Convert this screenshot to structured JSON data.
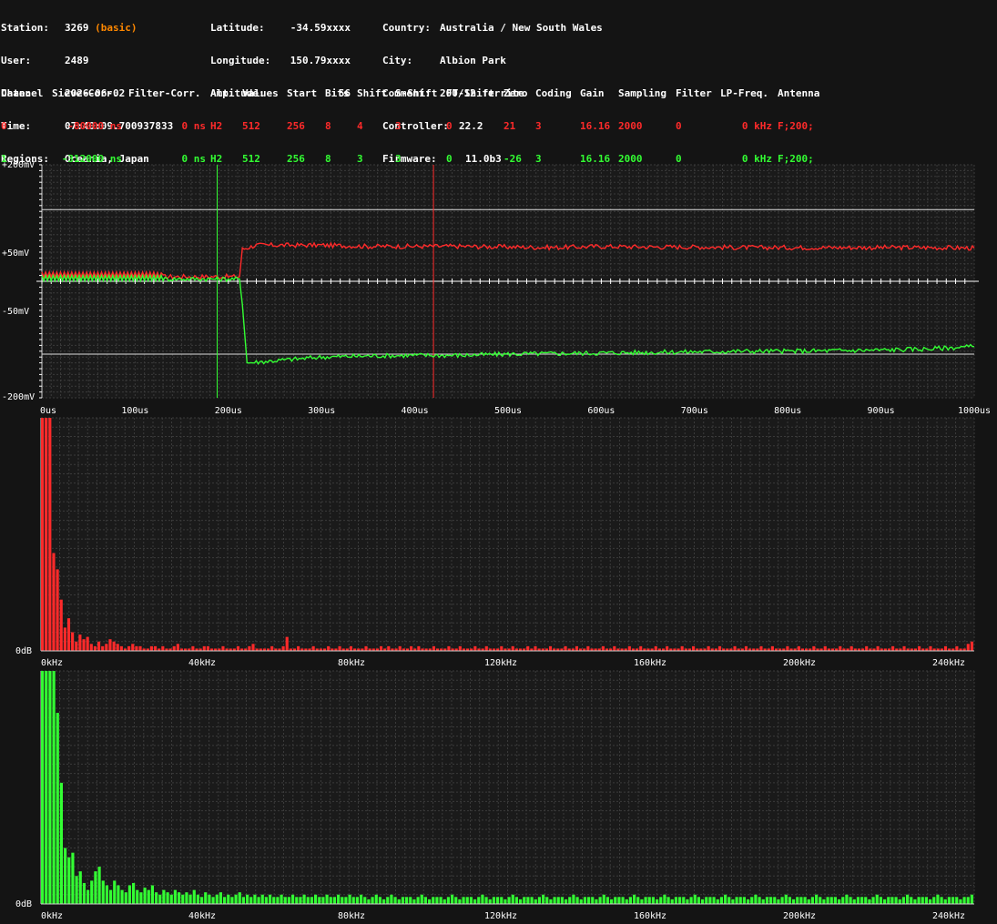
{
  "header": {
    "col1": [
      {
        "label": "Station:",
        "value": "3269",
        "extra": "(basic)"
      },
      {
        "label": "User:",
        "value": "2489"
      },
      {
        "label": "Date:",
        "value": "2026-06-02"
      },
      {
        "label": "Time:",
        "value": "07:40:09.700937833"
      },
      {
        "label": "Regions:",
        "value": "Oceania, Japan"
      }
    ],
    "col2": [
      {
        "label": "Latitude:",
        "value": "-34.59xxxx"
      },
      {
        "label": "Longitude:",
        "value": "150.79xxxx"
      },
      {
        "label": "Altitude:",
        "value": "56"
      }
    ],
    "col3": [
      {
        "label": "Country:",
        "value": "Australia / New South Wales"
      },
      {
        "label": "City:",
        "value": "Albion Park"
      },
      {
        "label": "Comment:",
        "value": "200/12 ferrite"
      },
      {
        "label": "Controller:",
        "value": "22.2"
      },
      {
        "label": "Firmware:",
        "value": "11.0b3"
      }
    ]
  },
  "channel_table": {
    "headers": [
      "Channel",
      "Sieve-Corr.",
      "Filter-Corr.",
      "Amp.",
      "Values",
      "Start",
      "Bits",
      "Shift",
      "S-Shift",
      "FT-Shift",
      "Zero",
      "Coding",
      "Gain",
      "Sampling",
      "Filter",
      "LP-Freq.",
      "Antenna"
    ],
    "rows": [
      {
        "color": "#ff2a2a",
        "cells": [
          "0",
          "-80000 ns",
          "0 ns",
          "H2",
          "512",
          "256",
          "8",
          "4",
          "3",
          "0",
          "21",
          "3",
          "16.16",
          "2000",
          "0",
          "0 kHz",
          "F;200;"
        ]
      },
      {
        "color": "#33ff33",
        "cells": [
          "1",
          "-312000 ns",
          "0 ns",
          "H2",
          "512",
          "256",
          "8",
          "3",
          "3",
          "0",
          "-26",
          "3",
          "16.16",
          "2000",
          "0",
          "0 kHz",
          "F;200;"
        ]
      }
    ]
  },
  "colors": {
    "background": "#141414",
    "plot_background": "#1a1a1a",
    "grid": "#3a3a3a",
    "ch0": "#ff2a2a",
    "ch1": "#33ff33"
  },
  "chart_data": [
    {
      "type": "line",
      "ylim": [
        -200,
        200
      ],
      "xlim": [
        0,
        1000
      ],
      "y_tick_labels": [
        {
          "value": 200,
          "label": "+200mV"
        },
        {
          "value": 50,
          "label": "+50mV"
        },
        {
          "value": -50,
          "label": "-50mV"
        },
        {
          "value": -200,
          "label": "-200mV"
        }
      ],
      "x_tick_labels": [
        "0us",
        "100us",
        "200us",
        "300us",
        "400us",
        "500us",
        "600us",
        "700us",
        "800us",
        "900us",
        "1000us"
      ],
      "reference_lines_mV": [
        123,
        -125
      ],
      "markers_us": [
        {
          "x": 188,
          "color": "#33ff33"
        },
        {
          "x": 420,
          "color": "#ff2a2a"
        }
      ],
      "series": [
        {
          "color": "#ff2a2a",
          "x": [
            0,
            60,
            120,
            130,
            180,
            200,
            212,
            215,
            230,
            260,
            300,
            350,
            400,
            450,
            500,
            550,
            600,
            650,
            700,
            750,
            800,
            850,
            900,
            950,
            1000
          ],
          "y": [
            10,
            10,
            10,
            8,
            8,
            8,
            8,
            55,
            62,
            62,
            62,
            60,
            60,
            60,
            59,
            58,
            60,
            59,
            59,
            58,
            58,
            58,
            58,
            58,
            57
          ]
        },
        {
          "color": "#33ff33",
          "x": [
            0,
            60,
            120,
            130,
            180,
            200,
            212,
            215,
            220,
            260,
            300,
            350,
            400,
            450,
            500,
            550,
            600,
            650,
            700,
            750,
            800,
            850,
            900,
            950,
            1000
          ],
          "y": [
            4,
            4,
            4,
            4,
            4,
            4,
            4,
            -40,
            -140,
            -135,
            -130,
            -128,
            -127,
            -127,
            -125,
            -124,
            -123,
            -122,
            -121,
            -120,
            -120,
            -119,
            -118,
            -116,
            -112
          ]
        }
      ]
    },
    {
      "type": "bar",
      "color": "#ff2a2a",
      "ylim": [
        0,
        100
      ],
      "y_tick_labels": [
        {
          "value": 0,
          "label": "0dB"
        }
      ],
      "x_tick_labels": [
        "0kHz",
        "40kHz",
        "80kHz",
        "120kHz",
        "160kHz",
        "200kHz",
        "240kHz"
      ],
      "bin_width_kHz": 0.98,
      "values": [
        100,
        100,
        100,
        42,
        35,
        22,
        10,
        14,
        8,
        4,
        7,
        5,
        6,
        3,
        2,
        4,
        2,
        3,
        5,
        4,
        3,
        2,
        1,
        2,
        3,
        2,
        2,
        1,
        1,
        2,
        2,
        1,
        2,
        1,
        1,
        2,
        3,
        1,
        1,
        1,
        2,
        1,
        1,
        2,
        2,
        1,
        1,
        1,
        2,
        1,
        1,
        1,
        2,
        1,
        1,
        2,
        3,
        1,
        1,
        1,
        1,
        2,
        1,
        1,
        2,
        6,
        1,
        1,
        2,
        1,
        1,
        1,
        2,
        1,
        1,
        1,
        2,
        1,
        1,
        2,
        1,
        1,
        2,
        1,
        1,
        1,
        2,
        1,
        1,
        1,
        2,
        1,
        2,
        1,
        1,
        2,
        1,
        1,
        2,
        1,
        2,
        1,
        1,
        1,
        2,
        1,
        1,
        1,
        2,
        1,
        1,
        2,
        1,
        1,
        1,
        2,
        1,
        1,
        2,
        1,
        1,
        1,
        2,
        1,
        1,
        2,
        1,
        1,
        1,
        2,
        1,
        2,
        1,
        1,
        1,
        2,
        1,
        1,
        1,
        2,
        1,
        1,
        2,
        1,
        1,
        2,
        1,
        1,
        1,
        2,
        1,
        1,
        2,
        1,
        1,
        1,
        2,
        1,
        1,
        2,
        1,
        1,
        1,
        2,
        1,
        1,
        2,
        1,
        1,
        1,
        2,
        1,
        1,
        2,
        1,
        1,
        1,
        2,
        1,
        1,
        2,
        1,
        1,
        1,
        2,
        1,
        1,
        2,
        1,
        1,
        1,
        2,
        1,
        1,
        2,
        1,
        1,
        1,
        2,
        1,
        1,
        2,
        1,
        1,
        1,
        2,
        1,
        1,
        2,
        1,
        1,
        1,
        2,
        1,
        1,
        2,
        1,
        1,
        1,
        2,
        1,
        1,
        2,
        1,
        1,
        1,
        2,
        1,
        1,
        2,
        1,
        1,
        1,
        2,
        1,
        1,
        2,
        1,
        1,
        1,
        2,
        1,
        1,
        2,
        1,
        1,
        3,
        4
      ]
    },
    {
      "type": "bar",
      "color": "#33ff33",
      "ylim": [
        0,
        100
      ],
      "y_tick_labels": [
        {
          "value": 0,
          "label": "0dB"
        }
      ],
      "x_tick_labels": [
        "0kHz",
        "40kHz",
        "80kHz",
        "120kHz",
        "160kHz",
        "200kHz",
        "240kHz"
      ],
      "bin_width_kHz": 0.98,
      "values": [
        100,
        100,
        100,
        100,
        82,
        52,
        24,
        20,
        22,
        12,
        14,
        9,
        6,
        10,
        14,
        16,
        10,
        8,
        6,
        10,
        8,
        6,
        5,
        8,
        9,
        6,
        5,
        7,
        6,
        8,
        5,
        4,
        6,
        5,
        4,
        6,
        5,
        4,
        5,
        4,
        6,
        4,
        3,
        5,
        4,
        3,
        4,
        5,
        3,
        4,
        3,
        4,
        5,
        3,
        4,
        3,
        4,
        3,
        4,
        3,
        4,
        3,
        3,
        4,
        3,
        3,
        4,
        3,
        3,
        4,
        3,
        3,
        4,
        3,
        3,
        4,
        3,
        3,
        4,
        3,
        3,
        4,
        3,
        3,
        4,
        3,
        2,
        3,
        4,
        3,
        2,
        3,
        4,
        3,
        2,
        3,
        3,
        3,
        2,
        3,
        4,
        3,
        2,
        3,
        3,
        3,
        2,
        3,
        4,
        3,
        2,
        3,
        3,
        3,
        2,
        3,
        4,
        3,
        2,
        3,
        3,
        3,
        2,
        3,
        4,
        3,
        2,
        3,
        3,
        3,
        2,
        3,
        4,
        3,
        2,
        3,
        3,
        3,
        2,
        3,
        4,
        3,
        2,
        3,
        3,
        3,
        2,
        3,
        4,
        3,
        2,
        3,
        3,
        3,
        2,
        3,
        4,
        3,
        2,
        3,
        3,
        3,
        2,
        3,
        4,
        3,
        2,
        3,
        3,
        3,
        2,
        3,
        4,
        3,
        2,
        3,
        3,
        3,
        2,
        3,
        4,
        3,
        2,
        3,
        3,
        3,
        2,
        3,
        4,
        3,
        2,
        3,
        3,
        3,
        2,
        3,
        4,
        3,
        2,
        3,
        3,
        3,
        2,
        3,
        4,
        3,
        2,
        3,
        3,
        3,
        2,
        3,
        4,
        3,
        2,
        3,
        3,
        3,
        2,
        3,
        4,
        3,
        2,
        3,
        3,
        3,
        2,
        3,
        4,
        3,
        2,
        3,
        3,
        3,
        2,
        3,
        4,
        3,
        2,
        3,
        3,
        3,
        2,
        3,
        3,
        4
      ]
    }
  ]
}
